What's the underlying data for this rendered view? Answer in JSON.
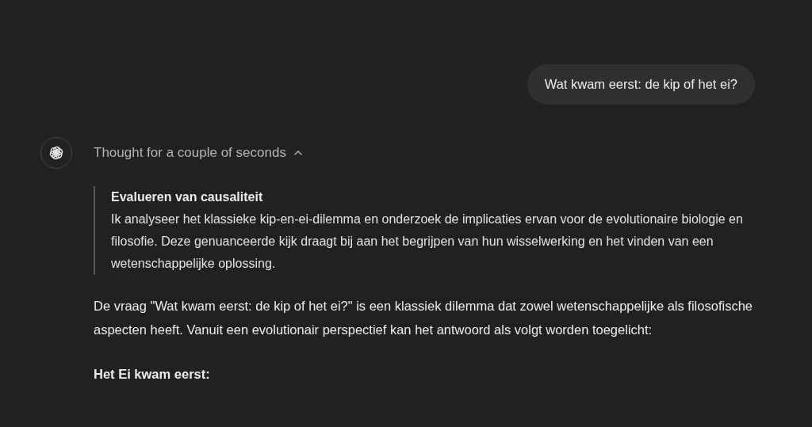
{
  "user_message": {
    "text": "Wat kwam eerst: de kip of het ei?"
  },
  "assistant": {
    "thought": {
      "label": "Thought for a couple of seconds",
      "expanded": true,
      "title": "Evalueren van causaliteit",
      "text": "Ik analyseer het klassieke kip-en-ei-dilemma en onderzoek de implicaties ervan voor de evolutionaire biologie en filosofie. Deze genuanceerde kijk draagt bij aan het begrijpen van hun wisselwerking en het vinden van een wetenschappelijke oplossing."
    },
    "paragraphs": [
      {
        "kind": "text",
        "text": "De vraag \"Wat kwam eerst: de kip of het ei?\" is een klassiek dilemma dat zowel wetenschappelijke als filosofische aspecten heeft. Vanuit een evolutionair perspectief kan het antwoord als volgt worden toegelicht:"
      },
      {
        "kind": "heading",
        "text": "Het Ei kwam eerst:"
      }
    ]
  }
}
